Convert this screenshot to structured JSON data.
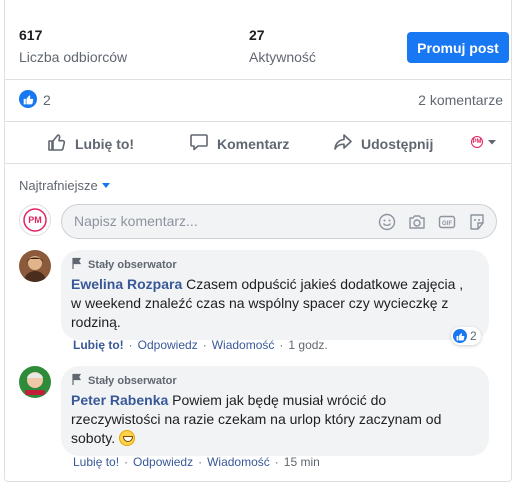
{
  "stats": {
    "reach": {
      "value": "617",
      "label": "Liczba odbiorców"
    },
    "engagement": {
      "value": "27",
      "label": "Aktywność"
    },
    "promote_label": "Promuj post"
  },
  "reactions": {
    "count": "2",
    "comments": "2 komentarze"
  },
  "actions": {
    "like": "Lubię to!",
    "comment": "Komentarz",
    "share": "Udostępnij",
    "page_logo_text": "PM"
  },
  "sort": {
    "label": "Najtrafniejsze"
  },
  "composer": {
    "placeholder": "Napisz komentarz...",
    "avatar_text": "PM"
  },
  "comments": [
    {
      "badge": "Stały obserwator",
      "author": "Ewelina Rozpara",
      "text": "Czasem odpuścić jakieś dodatkowe zajęcia , w weekend znaleźć czas na wspólny spacer czy wycieczkę z rodziną.",
      "like": "Lubię to!",
      "reply": "Odpowiedz",
      "message": "Wiadomość",
      "time": "1 godz.",
      "reaction_count": "2"
    },
    {
      "badge": "Stały obserwator",
      "author": "Peter Rabenka",
      "text": "Powiem jak będę musiał wrócić do rzeczywistości na razie czekam na urlop który zaczynam od soboty.",
      "like": "Lubię to!",
      "reply": "Odpowiedz",
      "message": "Wiadomość",
      "time": "15 min"
    }
  ],
  "colors": {
    "accent": "#1877f2",
    "link": "#385898",
    "muted": "#606770",
    "bubble": "#f2f3f5"
  }
}
